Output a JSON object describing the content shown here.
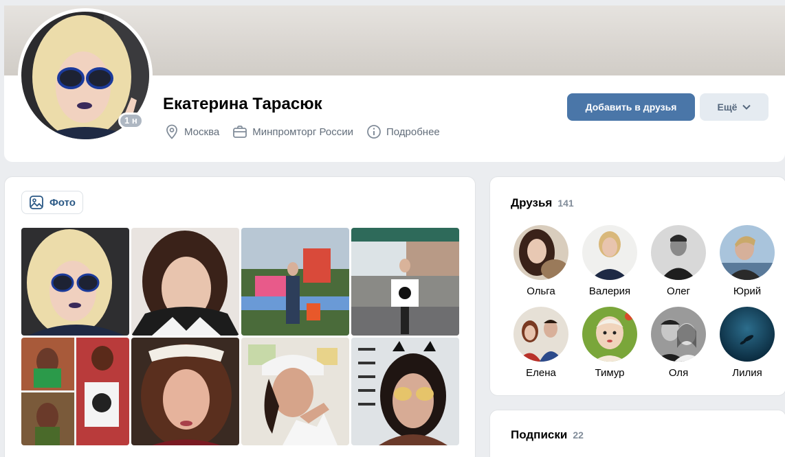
{
  "profile": {
    "name": "Екатерина Тарасюк",
    "online_badge": "1 н",
    "city": "Москва",
    "work": "Минпромторг России",
    "details": "Подробнее",
    "add_friend_label": "Добавить в друзья",
    "more_label": "Ещё"
  },
  "photos": {
    "tab_label": "Фото"
  },
  "friends": {
    "title": "Друзья",
    "count": "141",
    "items": [
      {
        "name": "Ольга"
      },
      {
        "name": "Валерия"
      },
      {
        "name": "Олег"
      },
      {
        "name": "Юрий"
      },
      {
        "name": "Елена"
      },
      {
        "name": "Тимур"
      },
      {
        "name": "Оля"
      },
      {
        "name": "Лилия"
      }
    ]
  },
  "subscriptions": {
    "title": "Подписки",
    "count": "22"
  },
  "colors": {
    "accent": "#4a76a8",
    "secondary_button": "#e5ebf1",
    "muted_text": "#626d7a",
    "background": "#ebedf0"
  },
  "icons": [
    "location-pin-icon",
    "briefcase-icon",
    "info-icon",
    "chevron-down-icon",
    "image-icon"
  ]
}
